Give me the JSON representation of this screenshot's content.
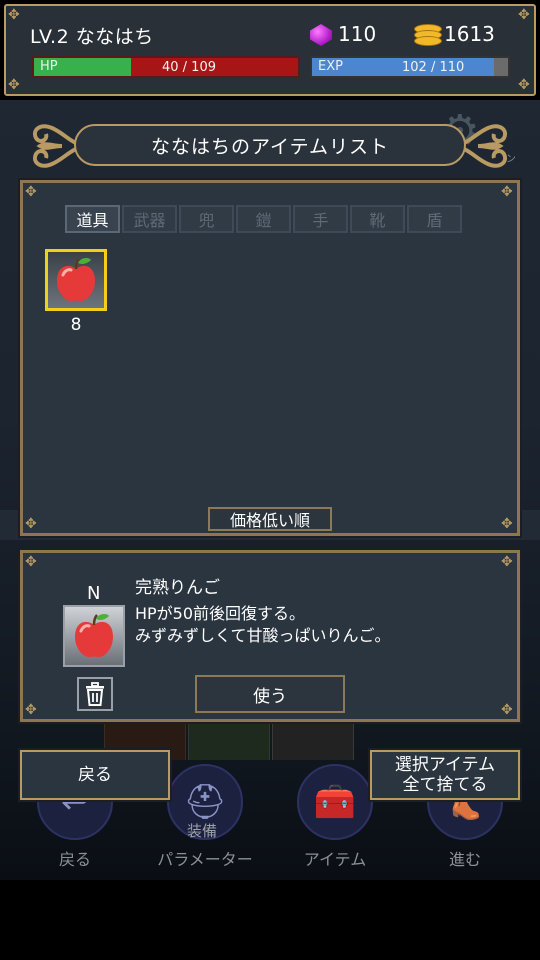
{
  "status": {
    "level_label": "LV.2 ななはち",
    "gems": "110",
    "coins": "1613",
    "hp": {
      "tag": "HP",
      "current": 40,
      "max": 109,
      "text": "40 / 109"
    },
    "exp": {
      "tag": "EXP",
      "current": 102,
      "max": 110,
      "text": "102 / 110"
    }
  },
  "title": "ななはちのアイテムリスト",
  "tabs": [
    {
      "label": "道具",
      "active": true
    },
    {
      "label": "武器",
      "active": false
    },
    {
      "label": "兜",
      "active": false
    },
    {
      "label": "鎧",
      "active": false
    },
    {
      "label": "手",
      "active": false
    },
    {
      "label": "靴",
      "active": false
    },
    {
      "label": "盾",
      "active": false
    }
  ],
  "items": [
    {
      "icon": "apple-icon",
      "count": "8",
      "selected": true
    }
  ],
  "sort_label": "価格低い順",
  "detail": {
    "rarity": "N",
    "name": "完熟りんご",
    "description": "HPが50前後回復する。\nみずみずしくて甘酸っぱいりんご。",
    "use_label": "使う",
    "trash_icon": "trash-icon"
  },
  "buttons": {
    "back": "戻る",
    "discard_selected": "選択アイテム\n全て捨てる"
  },
  "background_dock": [
    {
      "label": "戻る",
      "icon": "back-arrow-icon"
    },
    {
      "label": "パラメーター",
      "sub": "装備",
      "icon": "helmet-icon"
    },
    {
      "label": "アイテム",
      "icon": "toolbox-icon"
    },
    {
      "label": "進む",
      "icon": "boot-icon"
    }
  ],
  "colors": {
    "frame_gold": "#b89a62",
    "hp_fill": "#39b14a",
    "hp_empty": "#a81515",
    "exp_fill": "#4c86cf",
    "selected_border": "#f2d019"
  }
}
